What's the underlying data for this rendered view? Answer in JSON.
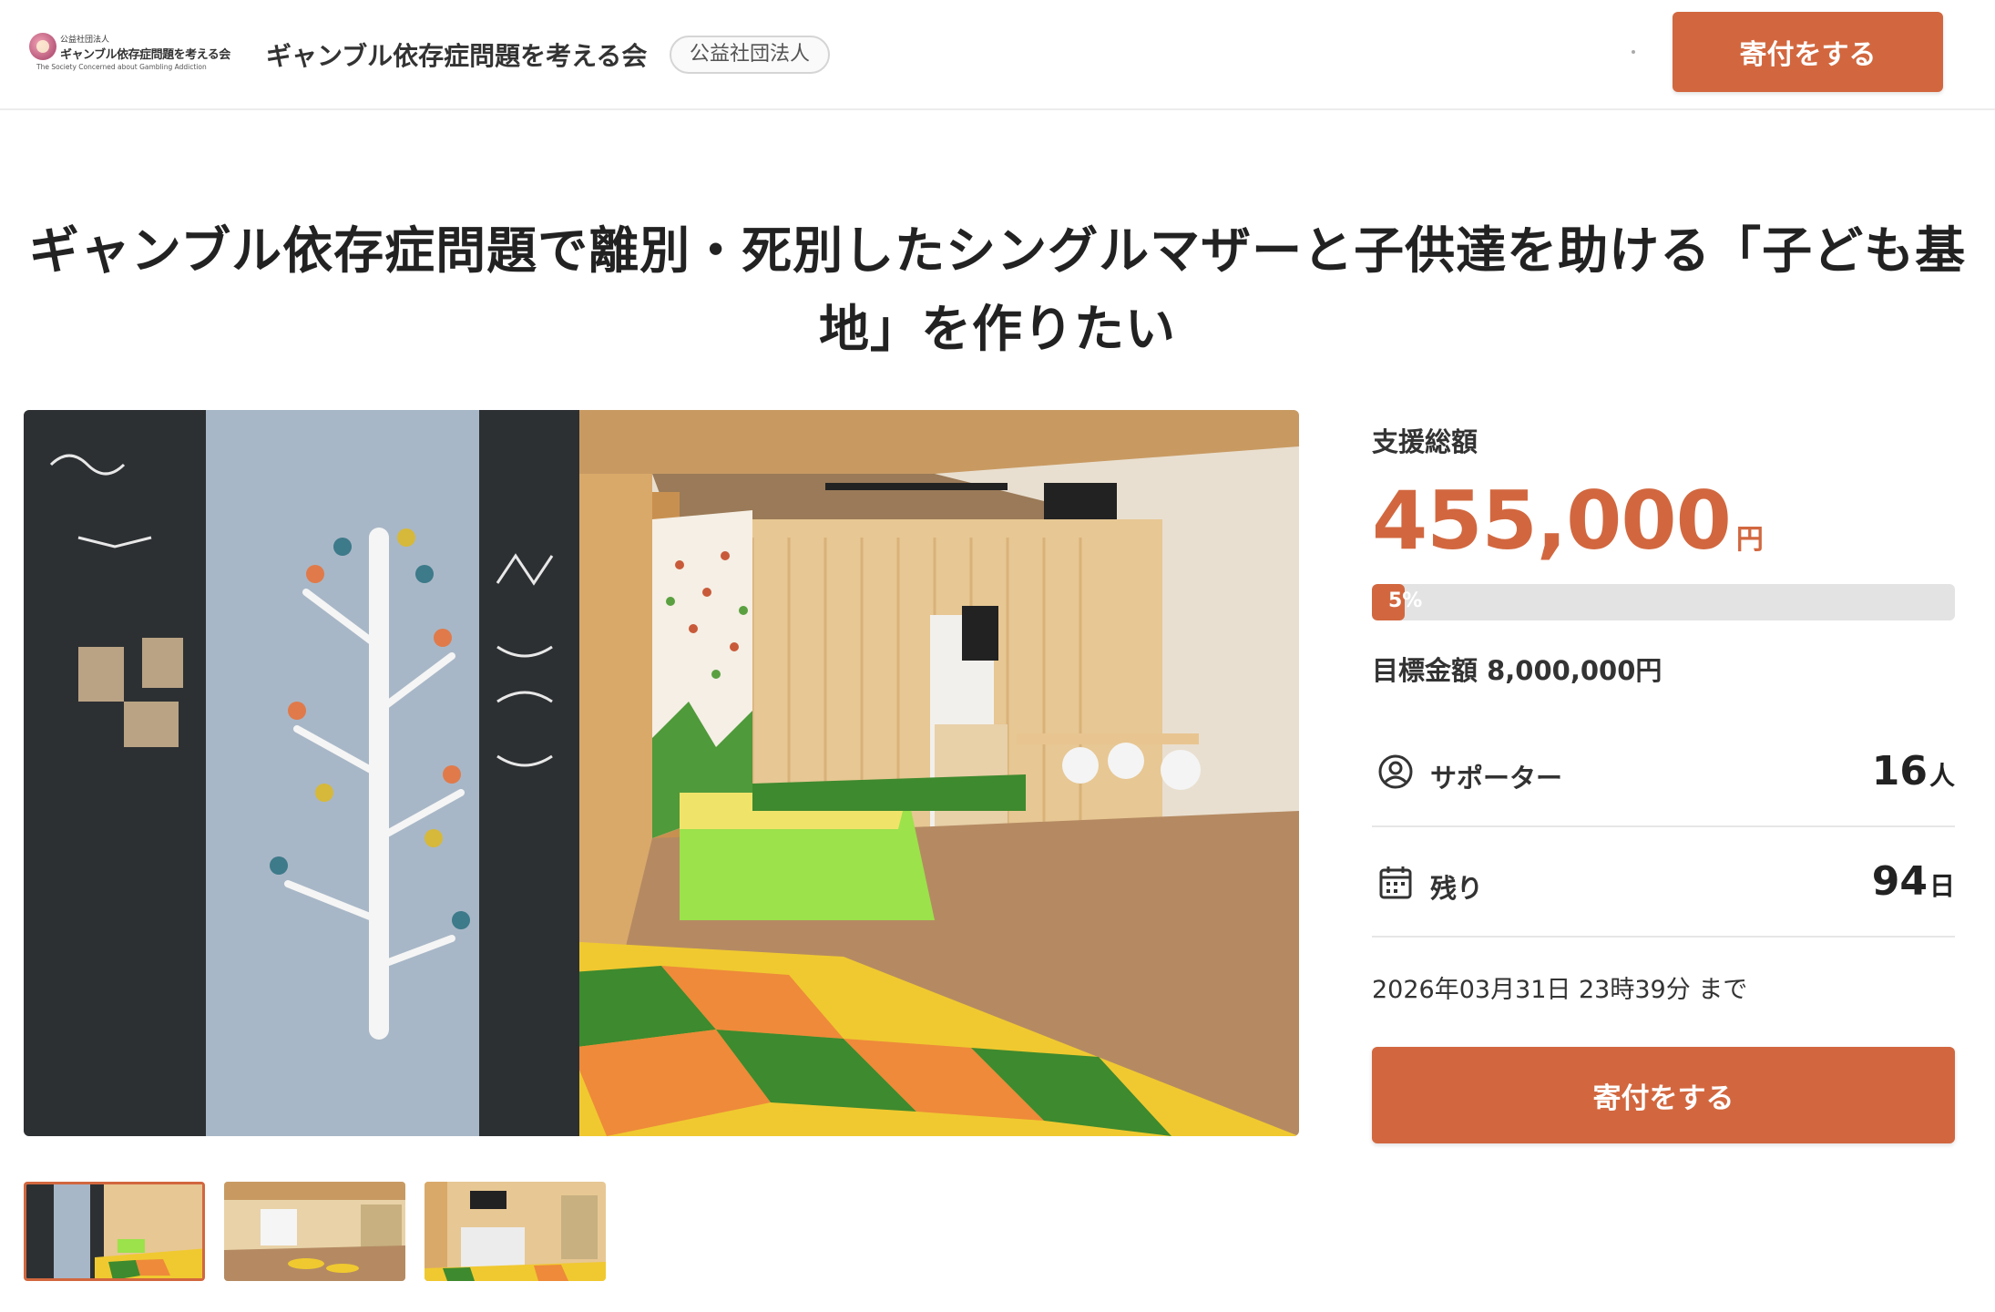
{
  "header": {
    "logo": {
      "line1": "公益社団法人",
      "line2": "ギャンブル依存症問題を考える会",
      "line3": "The Society Concerned about Gambling Addiction"
    },
    "org_name": "ギャンブル依存症問題を考える会",
    "org_badge": "公益社団法人",
    "donate_label": "寄付をする"
  },
  "project": {
    "title": "ギャンブル依存症問題で離別・死別したシングルマザーと子供達を助ける「子ども基地」を作りたい"
  },
  "gallery": {
    "main_image": "children-base-interior-rendering",
    "thumbnails": [
      {
        "name": "thumbnail-1",
        "active": true
      },
      {
        "name": "thumbnail-2",
        "active": false
      },
      {
        "name": "thumbnail-3",
        "active": false
      }
    ]
  },
  "funding": {
    "total_label": "支援総額",
    "amount": "455,000",
    "amount_unit": "円",
    "progress_percent": 5,
    "progress_label": "5%",
    "goal": "目標金額 8,000,000円",
    "supporters_label": "サポーター",
    "supporters_value": "16",
    "supporters_unit": "人",
    "remaining_label": "残り",
    "remaining_value": "94",
    "remaining_unit": "日",
    "deadline": "2026年03月31日 23時39分 まで",
    "donate_label": "寄付をする"
  },
  "colors": {
    "accent": "#d2673f",
    "progress_track": "#e3e3e3"
  },
  "icons": {
    "supporters": "person-circle-icon",
    "remaining": "calendar-icon"
  }
}
